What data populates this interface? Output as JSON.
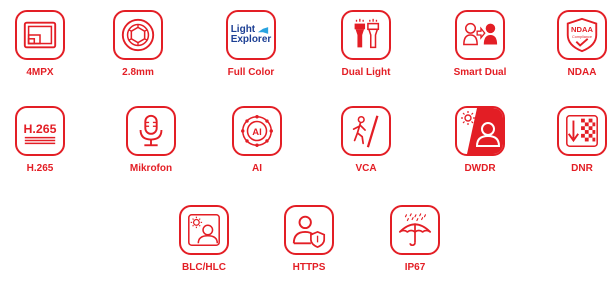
{
  "accent_color": "#e31e25",
  "features": [
    {
      "label": "4MPX",
      "icon": "resolution-icon"
    },
    {
      "label": "2.8mm",
      "icon": "lens-aperture-icon"
    },
    {
      "label": "Full Color",
      "icon": "light-explorer-logo",
      "logo_lines": [
        "Light",
        "Explorer"
      ]
    },
    {
      "label": "Dual Light",
      "icon": "dual-flashlight-icon"
    },
    {
      "label": "Smart Dual",
      "icon": "smart-dual-person-icon"
    },
    {
      "label": "NDAA",
      "icon": "ndaa-shield-icon",
      "badge_lines": [
        "NDAA",
        "Compliance"
      ]
    },
    {
      "label": "H.265",
      "icon": "h265-codec-icon",
      "badge_text": "H.265"
    },
    {
      "label": "Mikrofon",
      "icon": "microphone-icon"
    },
    {
      "label": "AI",
      "icon": "ai-chip-icon",
      "badge_text": "AI"
    },
    {
      "label": "VCA",
      "icon": "line-crossing-person-icon"
    },
    {
      "label": "DWDR",
      "icon": "dwdr-person-sun-icon"
    },
    {
      "label": "DNR",
      "icon": "dnr-noise-icon"
    },
    {
      "label": "BLC/HLC",
      "icon": "backlight-compensation-icon"
    },
    {
      "label": "HTTPS",
      "icon": "secure-user-shield-icon"
    },
    {
      "label": "IP67",
      "icon": "umbrella-rain-icon"
    }
  ]
}
